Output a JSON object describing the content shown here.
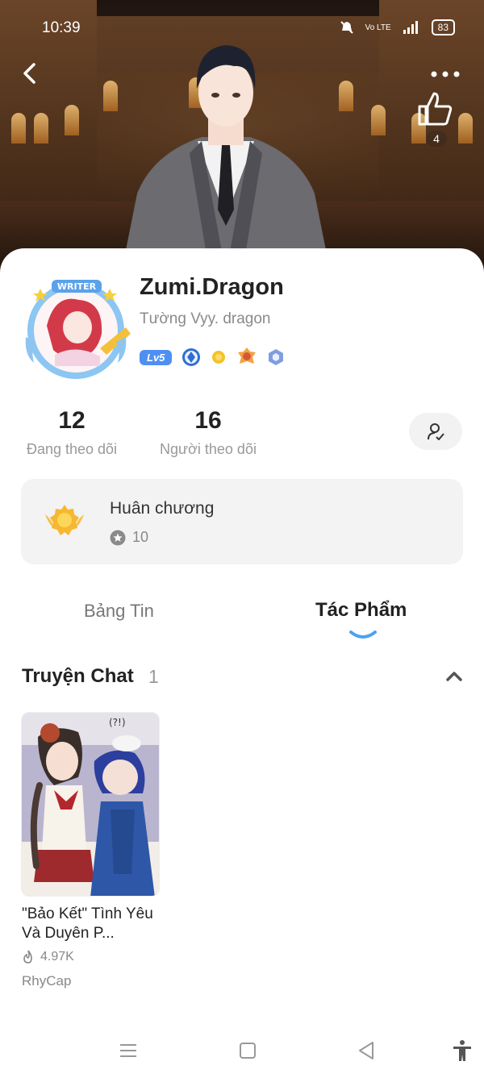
{
  "status_bar": {
    "time": "10:39",
    "battery": "83",
    "signal_label": "Vo LTE"
  },
  "header": {
    "like_count": "4"
  },
  "profile": {
    "name": "Zumi.Dragon",
    "subtitle": "Tường Vyy. dragon",
    "level": "Lv5",
    "avatar_badge_text": "WRITER"
  },
  "stats": {
    "following_count": "12",
    "following_label": "Đang theo dõi",
    "followers_count": "16",
    "followers_label": "Người theo dõi"
  },
  "medals": {
    "title": "Huân chương",
    "count": "10"
  },
  "tabs": [
    {
      "label": "Bảng Tin",
      "active": false
    },
    {
      "label": "Tác Phẩm",
      "active": true
    }
  ],
  "section": {
    "title": "Truyện Chat",
    "count": "1"
  },
  "works": [
    {
      "title": "\"Bảo Kết\" Tình Yêu Và Duyên P...",
      "reads": "4.97K",
      "author": "RhyCap"
    }
  ],
  "colors": {
    "accent": "#4e8ff2",
    "tab_indicator": "#4aa3f0",
    "card_bg": "#f3f3f3"
  }
}
